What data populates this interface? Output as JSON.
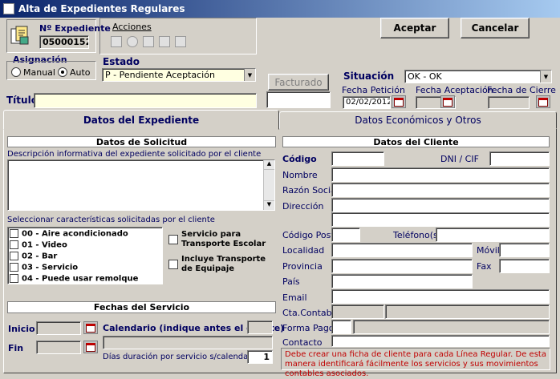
{
  "window": {
    "title": "Alta de Expedientes Regulares"
  },
  "expediente": {
    "label": "Nº Expediente",
    "value": "05000152"
  },
  "acciones": {
    "label": "Acciones"
  },
  "buttons": {
    "aceptar": "Aceptar",
    "cancelar": "Cancelar",
    "facturado": "Facturado"
  },
  "asignacion": {
    "label": "Asignación",
    "manual": "Manual",
    "auto": "Auto",
    "selected": "Auto"
  },
  "estado": {
    "label": "Estado",
    "value": "P - Pendiente Aceptación"
  },
  "situacion": {
    "label": "Situación",
    "value": "OK - OK"
  },
  "fechas_top": {
    "peticion_label": "Fecha Petición",
    "peticion_value": "02/02/2012",
    "aceptacion_label": "Fecha Aceptación",
    "cierre_label": "Fecha de Cierre"
  },
  "titulo": {
    "label": "Título",
    "value": ""
  },
  "tabs": [
    {
      "label": "Datos del Expediente"
    },
    {
      "label": "Datos Económicos y Otros"
    }
  ],
  "solicitud": {
    "header": "Datos de Solicitud",
    "desc_label": "Descripción informativa del expediente solicitado por el cliente",
    "caract_label": "Seleccionar características solicitadas por el cliente",
    "caracteristicas": [
      "00 - Aire acondicionado",
      "01 - Video",
      "02 - Bar",
      "03 - Servicio",
      "04 - Puede usar remolque"
    ],
    "servicio_transporte": "Servicio para Transporte Escolar",
    "incluye_transporte": "Incluye Transporte de Equipaje"
  },
  "fechas_servicio": {
    "header": "Fechas del Servicio",
    "inicio": "Inicio",
    "fin": "Fin",
    "calendario": "Calendario (indique antes el cliente)",
    "dias_label": "Días duración por servicio s/calendario",
    "dias_value": "1"
  },
  "cliente": {
    "header": "Datos del Cliente",
    "codigo": "Código",
    "dni": "DNI / CIF",
    "nombre": "Nombre",
    "razon": "Razón Social",
    "direccion": "Dirección",
    "cp": "Código Postal",
    "telefono": "Teléfono(s)",
    "localidad": "Localidad",
    "movil": "Móvil",
    "provincia": "Provincia",
    "fax": "Fax",
    "pais": "País",
    "email": "Email",
    "cta": "Cta.Contable",
    "forma_pago": "Forma Pago",
    "contacto": "Contacto",
    "nota": "Debe crear una ficha de cliente para cada Línea Regular. De esta manera identificará fácilmente los servicios y sus movimientos contables asociados."
  }
}
